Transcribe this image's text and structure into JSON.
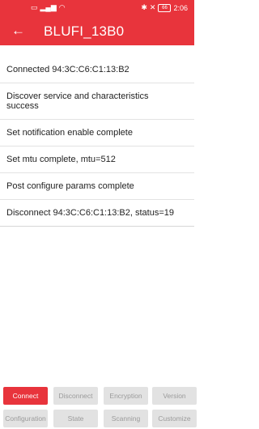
{
  "status_bar": {
    "left_icons": [
      "sim-icon",
      "signal-icon",
      "wifi-icon"
    ],
    "time": "2:06",
    "battery": "66"
  },
  "app_bar": {
    "back_label": "←",
    "title": "BLUFI_13B0"
  },
  "log": [
    "Connected 94:3C:C6:C1:13:B2",
    "Discover service and characteristics success",
    "Set notification enable  complete",
    "Set mtu complete, mtu=512",
    "Post configure params complete",
    "Disconnect 94:3C:C6:C1:13:B2, status=19"
  ],
  "buttons_row1": [
    "Connect",
    "Disconnect",
    "Encryption",
    "Version"
  ],
  "buttons_row2": [
    "Configuration",
    "State",
    "Scanning",
    "Customize"
  ],
  "colors": {
    "accent": "#e8343c",
    "disabled_bg": "#e2e2e2",
    "disabled_text": "#9b9b9b"
  }
}
